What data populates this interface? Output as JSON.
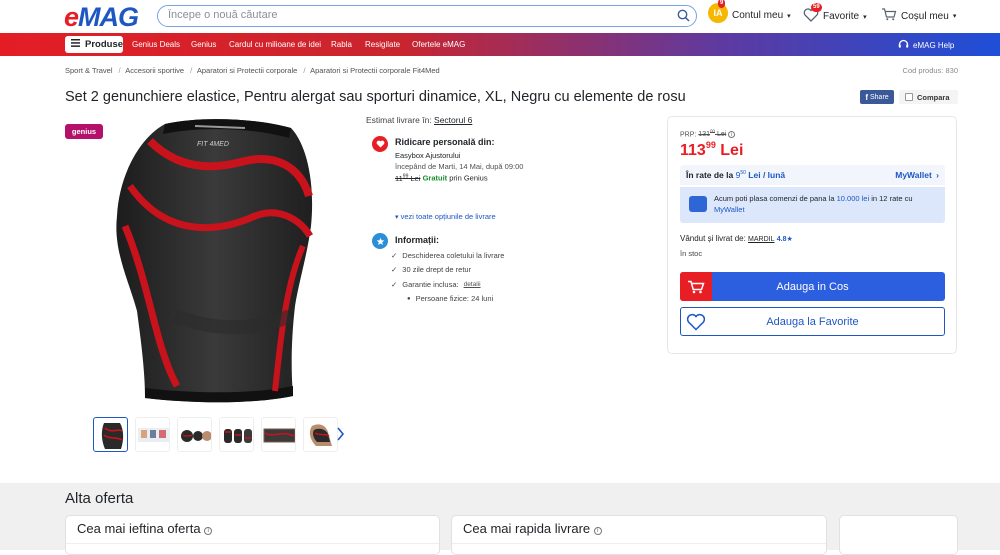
{
  "header": {
    "logo": {
      "e": "e",
      "mag": "MAG"
    },
    "search_placeholder": "Începe o nouă căutare",
    "account": {
      "initials": "IA",
      "badge": "9",
      "label": "Contul meu"
    },
    "favorites": {
      "badge": "59",
      "label": "Favorite"
    },
    "cart": {
      "label": "Coșul meu"
    }
  },
  "nav": {
    "products_label": "Produse",
    "items": [
      "Genius Deals",
      "Genius",
      "Cardul cu milioane de idei",
      "Rabla",
      "Resigilate",
      "Ofertele eMAG"
    ],
    "help_label": "eMAG Help"
  },
  "breadcrumbs": [
    "Sport & Travel",
    "Accesorii sportive",
    "Aparatori si Protectii corporale",
    "Aparatori si Protectii corporale Fit4Med"
  ],
  "product_code": "Cod produs: 830",
  "product": {
    "title": "Set 2 genunchiere elastice, Pentru alergat sau sporturi dinamice, XL, Negru cu elemente de rosu",
    "genius_badge": "genius",
    "brand_text": "FIT 4MED"
  },
  "share_label": "Share",
  "compare_label": "Compara",
  "delivery": {
    "estim_label": "Estimat livrare în:",
    "estim_area": "Sectorul 6",
    "pickup_title": "Ridicare personală din:",
    "pickup_place": "Easybox Ajustorului",
    "pickup_date": "începând de Marti, 14 Mai, după 09:00",
    "old_price": "11",
    "old_price_sup": "99",
    "old_price_currency": "Lei",
    "free_label": "Gratuit",
    "free_suffix": "prin Genius",
    "all_options_link": "vezi toate opțiunile de livrare",
    "info_title": "Informații:",
    "info_items": [
      "Deschiderea coletului la livrare",
      "30 zile drept de retur",
      "Garantie inclusa:"
    ],
    "warranty_link": "detalii",
    "warranty_person": "Persoane fizice: 24 luni"
  },
  "buybox": {
    "prp_label": "PRP:",
    "prp_value": "131",
    "prp_sup": "00",
    "prp_currency": "Lei",
    "price_int": "113",
    "price_sup": "99",
    "price_currency": "Lei",
    "installment_prefix": "În rate de la",
    "installment_int": "9",
    "installment_sup": "50",
    "installment_suffix": "Lei / lună",
    "mywallet_label": "MyWallet",
    "mywallet_text_1": "Acum poti plasa comenzi de pana la",
    "mywallet_amount": "10.000 lei",
    "mywallet_text_2": "in 12 rate cu",
    "mywallet_link": "MyWallet",
    "seller_label": "Vândut și livrat de:",
    "seller_name": "MARDIL",
    "seller_rating": "4.8",
    "stock": "în stoc",
    "add_to_cart": "Adauga in Cos",
    "add_to_fav": "Adauga la Favorite"
  },
  "offers": {
    "title": "Alta oferta",
    "cheapest": "Cea mai ieftina oferta",
    "fastest": "Cea mai rapida livrare"
  },
  "colors": {
    "brand_red": "#e81e25",
    "brand_blue": "#1d57c4",
    "genius_pink": "#b5116a"
  }
}
